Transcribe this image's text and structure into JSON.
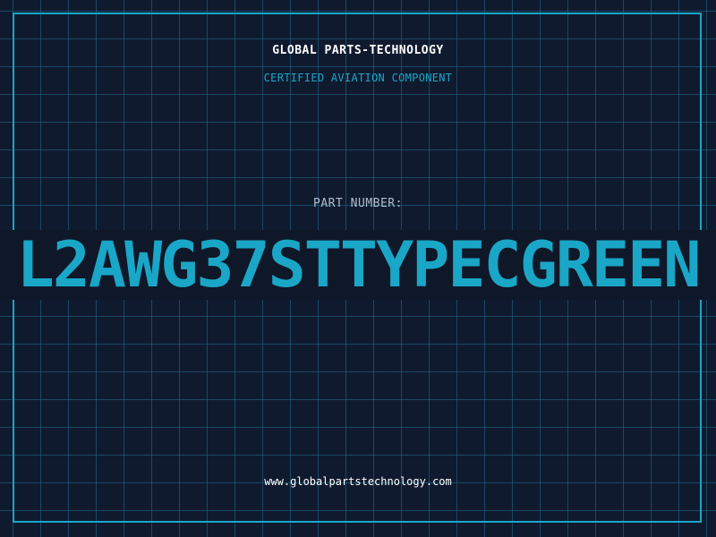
{
  "header": {
    "company_name": "GLOBAL PARTS-TECHNOLOGY",
    "subtitle": "CERTIFIED AVIATION COMPONENT"
  },
  "part": {
    "label": "PART NUMBER:",
    "value": "L2AWG37STTYPECGREEN"
  },
  "footer": {
    "website": "www.globalpartstechnology.com"
  },
  "colors": {
    "background": "#101a2f",
    "accent": "#1aa6c7",
    "grid": "#1e6e8c",
    "text": "#ffffff",
    "muted_text": "#b0bccb"
  }
}
